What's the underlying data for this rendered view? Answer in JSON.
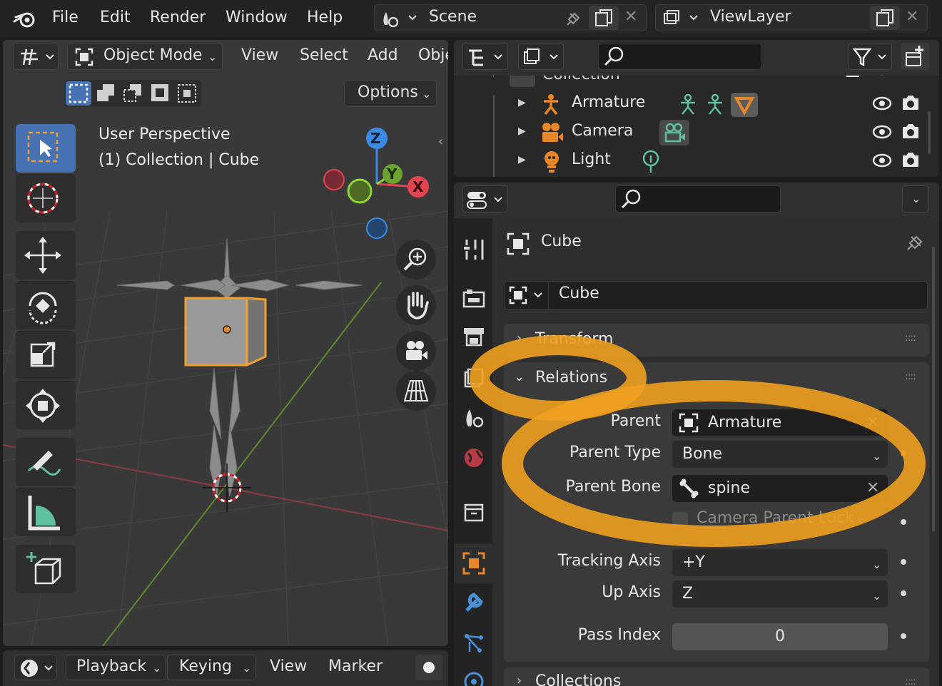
{
  "topbar": {
    "menus": [
      "File",
      "Edit",
      "Render",
      "Window",
      "Help"
    ],
    "scene": "Scene",
    "view_layer": "ViewLayer"
  },
  "viewport": {
    "mode": "Object Mode",
    "menus": [
      "View",
      "Select",
      "Add",
      "Obje"
    ],
    "options": "Options",
    "info_line1": "User Perspective",
    "info_line2": "(1) Collection | Cube",
    "gizmo": {
      "z": "Z",
      "y": "Y",
      "x": "X"
    }
  },
  "timeline": {
    "menus": [
      "Playback",
      "Keying",
      "View",
      "Marker"
    ]
  },
  "outliner": {
    "collection": "Collection",
    "items": [
      {
        "name": "Armature",
        "icon": "armature-icon",
        "color": "#e8862a"
      },
      {
        "name": "Camera",
        "icon": "camera-icon",
        "color": "#e8862a"
      },
      {
        "name": "Light",
        "icon": "light-icon",
        "color": "#e8862a"
      }
    ]
  },
  "properties": {
    "object_name": "Cube",
    "datablock_name": "Cube",
    "panels": {
      "transform": "Transform",
      "relations": "Relations",
      "collections": "Collections"
    },
    "relations": {
      "parent_label": "Parent",
      "parent_value": "Armature",
      "parent_type_label": "Parent Type",
      "parent_type_value": "Bone",
      "parent_bone_label": "Parent Bone",
      "parent_bone_value": "spine",
      "camera_parent_lock": "Camera Parent Lock",
      "tracking_axis_label": "Tracking Axis",
      "tracking_axis_value": "+Y",
      "up_axis_label": "Up Axis",
      "up_axis_value": "Z",
      "pass_index_label": "Pass Index",
      "pass_index_value": "0"
    }
  },
  "colors": {
    "accent": "#e8862a",
    "highlight_circle": "#f0a020",
    "active_tool": "#4772b3",
    "x_axis": "#e2434f",
    "y_axis": "#8bd43a",
    "z_axis": "#3a8ae8"
  }
}
